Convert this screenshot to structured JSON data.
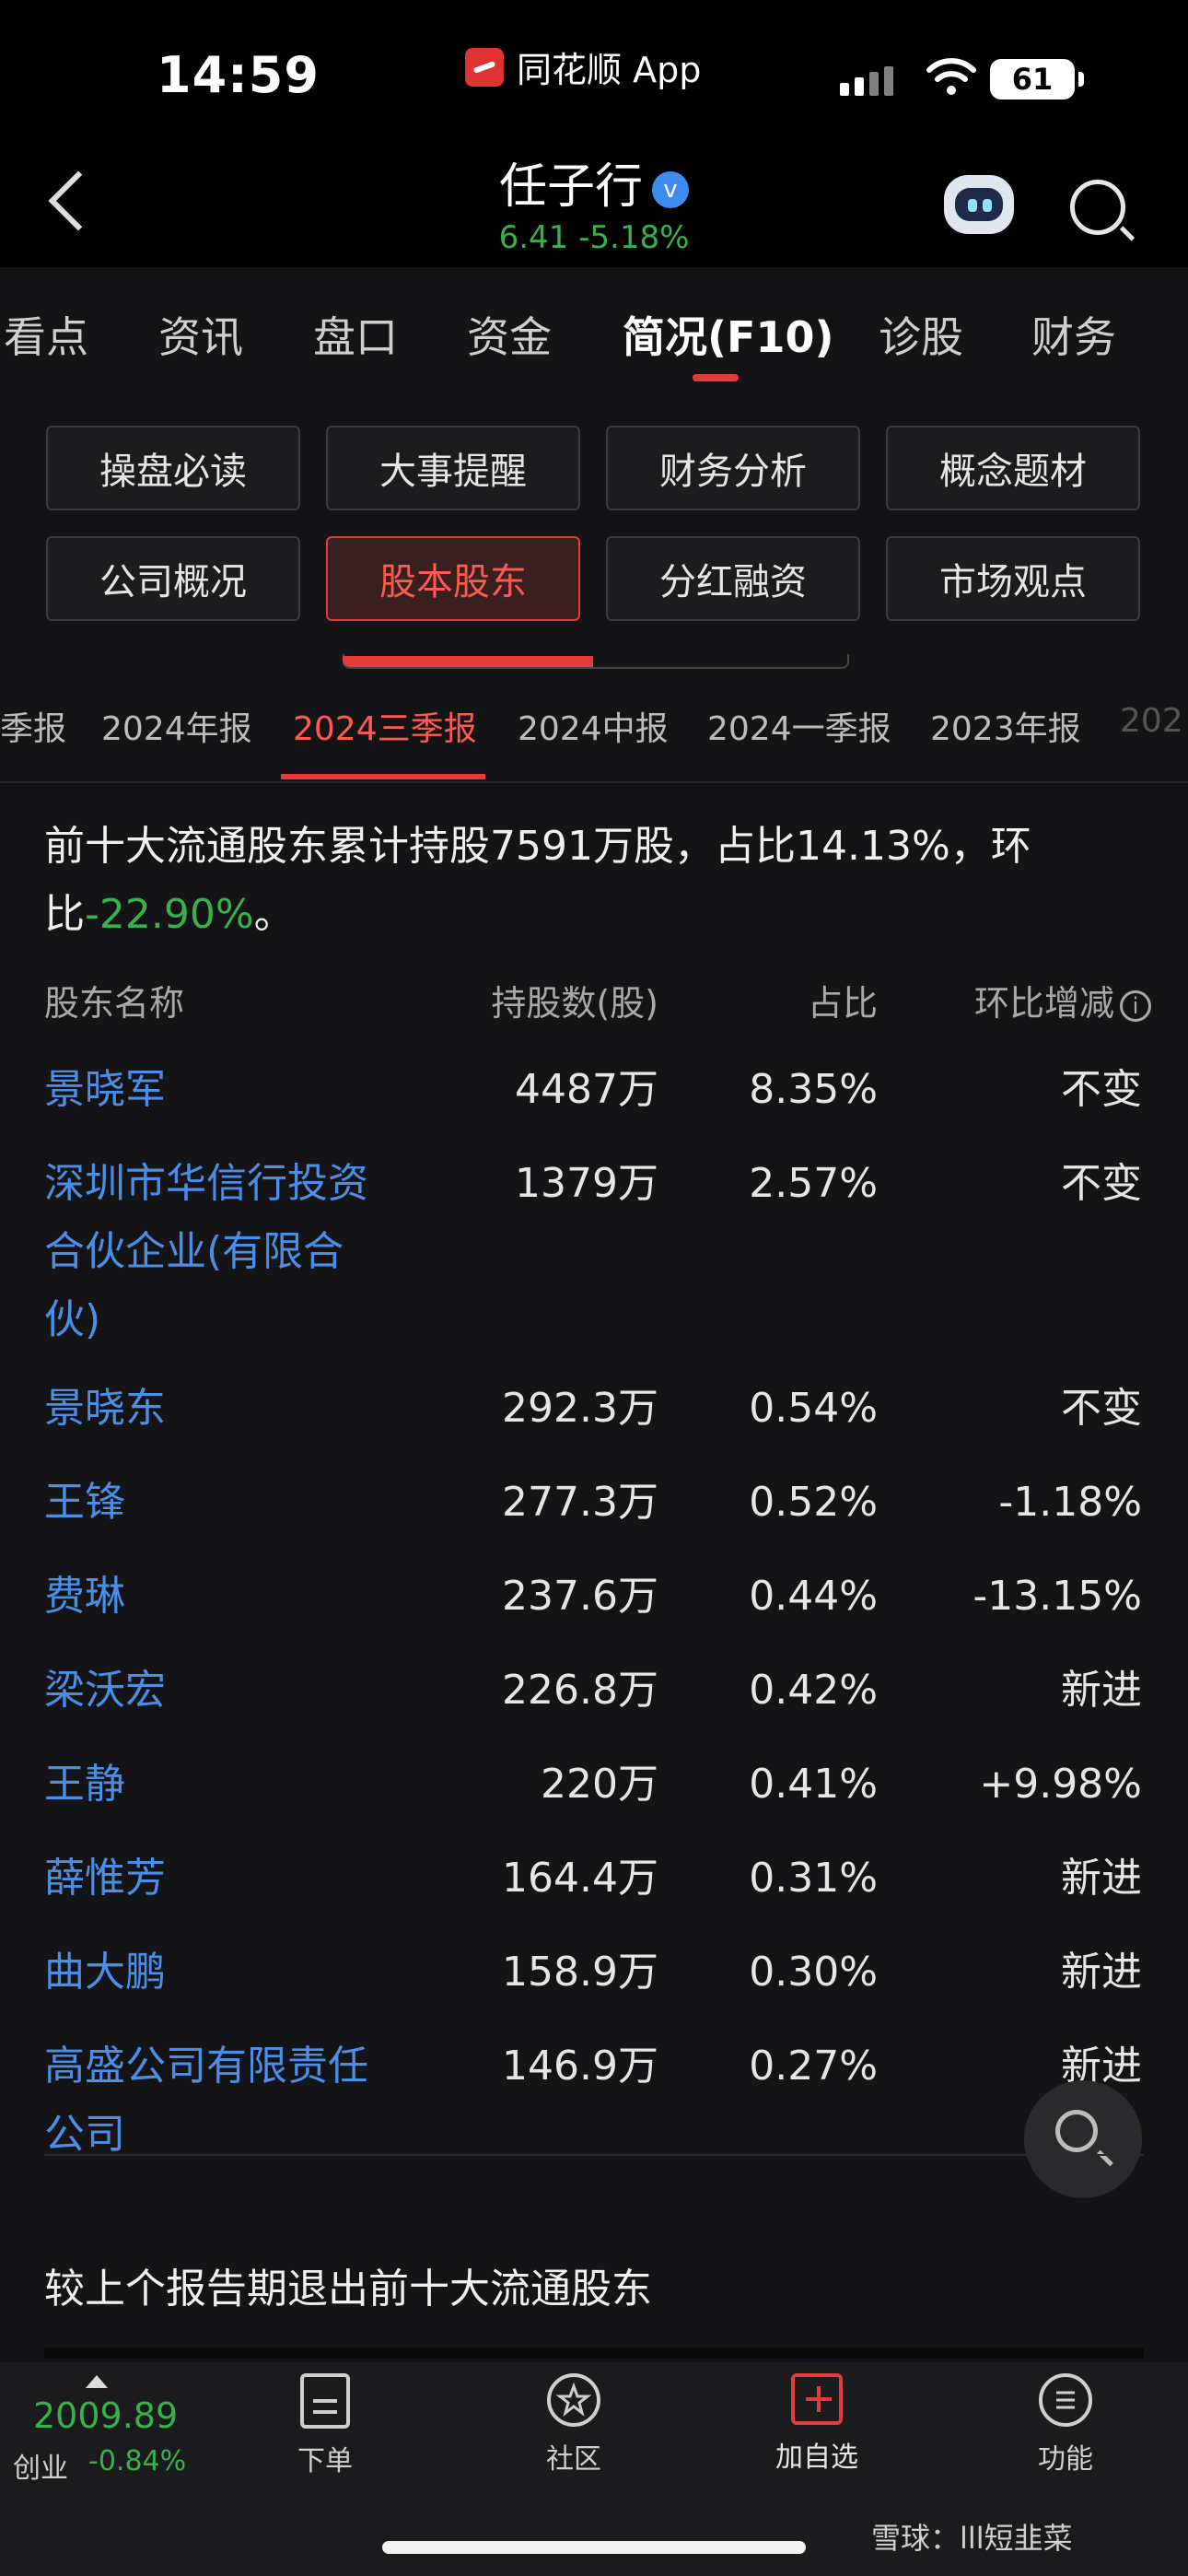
{
  "status_bar": {
    "time": "14:59",
    "app_label": "同花顺 App",
    "battery": "61"
  },
  "header": {
    "stock_name": "任子行",
    "verify_mark": "v",
    "price_line": "6.41 -5.18%"
  },
  "main_tabs": [
    "看点",
    "资讯",
    "盘口",
    "资金",
    "简况(F10)",
    "诊股",
    "财务"
  ],
  "grid_buttons": [
    "操盘必读",
    "大事提醒",
    "财务分析",
    "概念题材",
    "公司概况",
    "股本股东",
    "分红融资",
    "市场观点"
  ],
  "period_tabs": [
    "季报",
    "2024年报",
    "2024三季报",
    "2024中报",
    "2024一季报",
    "2023年报",
    "202"
  ],
  "summary": {
    "text_main": "前十大流通股东累计持股7591万股，占比14.13%，环比",
    "change": "-22.90%",
    "end": "。"
  },
  "table": {
    "headers": {
      "name": "股东名称",
      "shares": "持股数(股)",
      "pct": "占比",
      "chg": "环比增减",
      "info": "i"
    },
    "rows": [
      {
        "name": "景晓军",
        "shares": "4487万",
        "pct": "8.35%",
        "chg": "不变",
        "tone": "neutral"
      },
      {
        "name": "深圳市华信行投资合伙企业(有限合伙)",
        "shares": "1379万",
        "pct": "2.57%",
        "chg": "不变",
        "tone": "neutral"
      },
      {
        "name": "景晓东",
        "shares": "292.3万",
        "pct": "0.54%",
        "chg": "不变",
        "tone": "neutral"
      },
      {
        "name": "王锋",
        "shares": "277.3万",
        "pct": "0.52%",
        "chg": "-1.18%",
        "tone": "down"
      },
      {
        "name": "费琳",
        "shares": "237.6万",
        "pct": "0.44%",
        "chg": "-13.15%",
        "tone": "down"
      },
      {
        "name": "梁沃宏",
        "shares": "226.8万",
        "pct": "0.42%",
        "chg": "新进",
        "tone": "up"
      },
      {
        "name": "王静",
        "shares": "220万",
        "pct": "0.41%",
        "chg": "+9.98%",
        "tone": "up"
      },
      {
        "name": "薛惟芳",
        "shares": "164.4万",
        "pct": "0.31%",
        "chg": "新进",
        "tone": "up"
      },
      {
        "name": "曲大鹏",
        "shares": "158.9万",
        "pct": "0.30%",
        "chg": "新进",
        "tone": "up"
      },
      {
        "name": "高盛公司有限责任公司",
        "shares": "146.9万",
        "pct": "0.27%",
        "chg": "新进",
        "tone": "up"
      }
    ]
  },
  "exit_section_title": "较上个报告期退出前十大流通股东",
  "bottom_nav": {
    "index_value": "2009.89",
    "index_name": "创业",
    "index_change": "-0.84%",
    "items": [
      "下单",
      "社区",
      "加自选",
      "功能"
    ]
  },
  "watermark": "雪球：lll短韭菜",
  "colors": {
    "up": "#ff4d4d",
    "down": "#36b24a",
    "accent": "#e23b3b",
    "link": "#4b8ee6"
  }
}
